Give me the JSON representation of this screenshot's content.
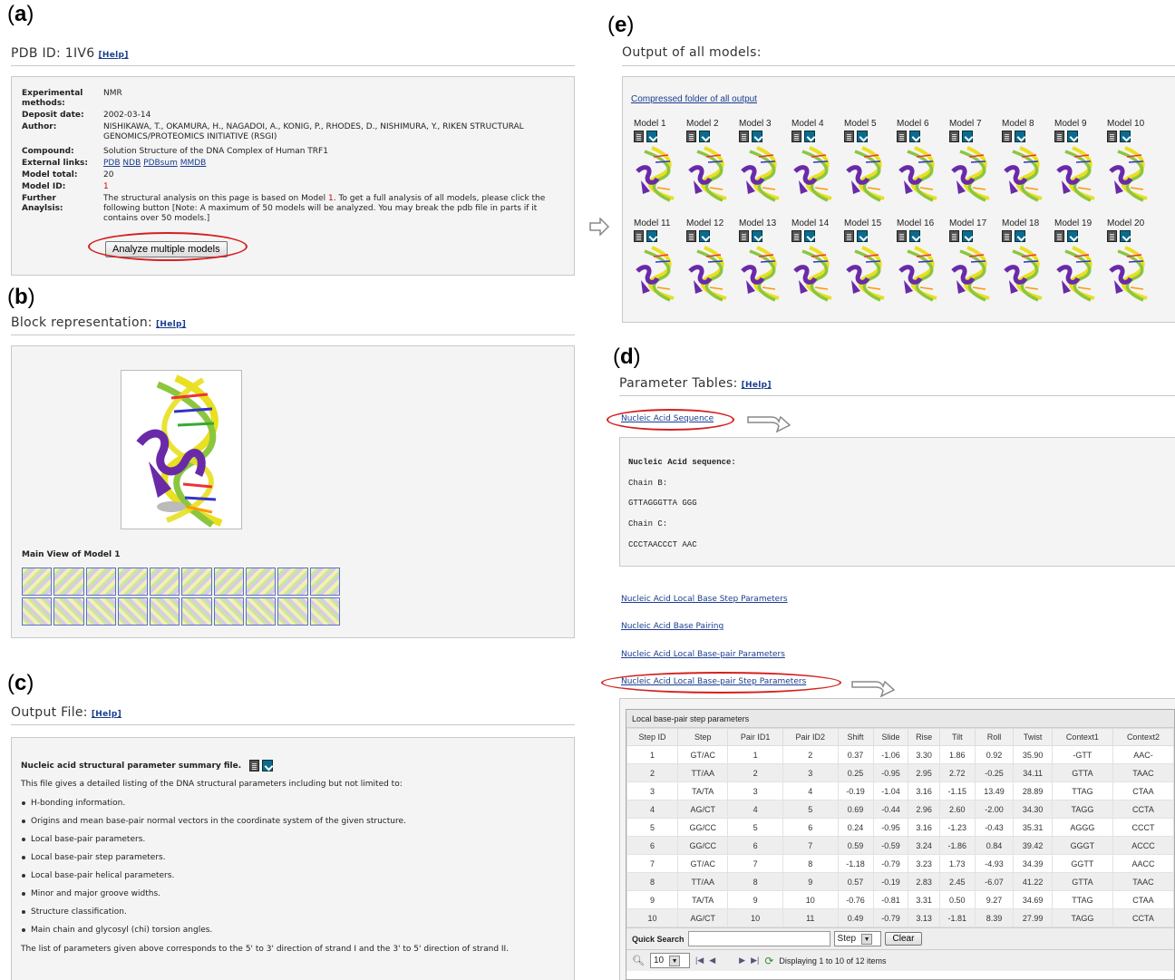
{
  "panels": {
    "a": "a",
    "b": "b",
    "c": "c",
    "d": "d",
    "e": "e"
  },
  "panel_a": {
    "title": "PDB ID: 1IV6",
    "help": "[Help]",
    "rows": [
      {
        "key": "Experimental methods:",
        "value": "NMR"
      },
      {
        "key": "Deposit date:",
        "value": "2002-03-14"
      },
      {
        "key": "Author:",
        "value": "NISHIKAWA, T., OKAMURA, H., NAGADOI, A., KONIG, P., RHODES, D., NISHIMURA, Y., RIKEN STRUCTURAL GENOMICS/PROTEOMICS INITIATIVE (RSGI)"
      },
      {
        "key": "Compound:",
        "value": "Solution Structure of the DNA Complex of Human TRF1"
      },
      {
        "key": "External links:",
        "links": [
          "PDB",
          "NDB",
          "PDBsum",
          "MMDB"
        ]
      },
      {
        "key": "Model total:",
        "value": "20"
      },
      {
        "key": "Model ID:",
        "value": "1"
      },
      {
        "key": "Further Anaylsis:",
        "value_pre": "The structural analysis on this page is based on Model ",
        "value_model": "1",
        "value_post": ". To get a full analysis of all models, please click the following button [Note: A maximum of 50 models will be analyzed. You may break the pdb file in parts if it contains over 50 models.]"
      }
    ],
    "button": "Analyze multiple models"
  },
  "panel_b": {
    "title": "Block representation:",
    "help": "[Help]",
    "caption": "Main View of Model 1"
  },
  "panel_c": {
    "title": "Output File:",
    "help": "[Help]",
    "heading": "Nucleic acid structural parameter summary file.",
    "intro": "This file gives a detailed listing of the DNA structural parameters including but not limited to:",
    "items": [
      "H-bonding information.",
      "Origins and mean base-pair normal vectors in the coordinate system of the given structure.",
      "Local base-pair parameters.",
      "Local base-pair step parameters.",
      "Local base-pair helical parameters.",
      "Minor and major groove widths.",
      "Structure classification.",
      "Main chain and glycosyl (chi) torsion angles."
    ],
    "footer": "The list of parameters given above corresponds to the 5' to 3' direction of strand I and the 3' to 5' direction of strand II."
  },
  "panel_e": {
    "title": "Output of all models:",
    "link": "Compressed folder of all output",
    "models": [
      "Model 1",
      "Model 2",
      "Model 3",
      "Model 4",
      "Model 5",
      "Model 6",
      "Model 7",
      "Model 8",
      "Model 9",
      "Model 10",
      "Model 11",
      "Model 12",
      "Model 13",
      "Model 14",
      "Model 15",
      "Model 16",
      "Model 17",
      "Model 18",
      "Model 19",
      "Model 20"
    ]
  },
  "panel_d": {
    "title": "Parameter Tables:",
    "help": "[Help]",
    "link_sequence": "Nucleic Acid Sequence",
    "seq_heading": "Nucleic Acid sequence:",
    "chain_b_label": "Chain B:",
    "chain_b_seq": "GTTAGGGTTA GGG",
    "chain_c_label": "Chain C:",
    "chain_c_seq": "CCCTAACCCT AAC",
    "links": [
      "Nucleic Acid Local Base Step Parameters",
      "Nucleic Acid Base Pairing",
      "Nucleic Acid Local Base-pair Parameters",
      "Nucleic Acid Local Base-pair Step Parameters"
    ],
    "table": {
      "caption": "Local base-pair step parameters",
      "columns": [
        "Step ID",
        "Step",
        "Pair ID1",
        "Pair ID2",
        "Shift",
        "Slide",
        "Rise",
        "Tilt",
        "Roll",
        "Twist",
        "Context1",
        "Context2"
      ],
      "rows": [
        [
          "1",
          "GT/AC",
          "1",
          "2",
          "0.37",
          "-1.06",
          "3.30",
          "1.86",
          "0.92",
          "35.90",
          "-GTT",
          "AAC-"
        ],
        [
          "2",
          "TT/AA",
          "2",
          "3",
          "0.25",
          "-0.95",
          "2.95",
          "2.72",
          "-0.25",
          "34.11",
          "GTTA",
          "TAAC"
        ],
        [
          "3",
          "TA/TA",
          "3",
          "4",
          "-0.19",
          "-1.04",
          "3.16",
          "-1.15",
          "13.49",
          "28.89",
          "TTAG",
          "CTAA"
        ],
        [
          "4",
          "AG/CT",
          "4",
          "5",
          "0.69",
          "-0.44",
          "2.96",
          "2.60",
          "-2.00",
          "34.30",
          "TAGG",
          "CCTA"
        ],
        [
          "5",
          "GG/CC",
          "5",
          "6",
          "0.24",
          "-0.95",
          "3.16",
          "-1.23",
          "-0.43",
          "35.31",
          "AGGG",
          "CCCT"
        ],
        [
          "6",
          "GG/CC",
          "6",
          "7",
          "0.59",
          "-0.59",
          "3.24",
          "-1.86",
          "0.84",
          "39.42",
          "GGGT",
          "ACCC"
        ],
        [
          "7",
          "GT/AC",
          "7",
          "8",
          "-1.18",
          "-0.79",
          "3.23",
          "1.73",
          "-4.93",
          "34.39",
          "GGTT",
          "AACC"
        ],
        [
          "8",
          "TT/AA",
          "8",
          "9",
          "0.57",
          "-0.19",
          "2.83",
          "2.45",
          "-6.07",
          "41.22",
          "GTTA",
          "TAAC"
        ],
        [
          "9",
          "TA/TA",
          "9",
          "10",
          "-0.76",
          "-0.81",
          "3.31",
          "0.50",
          "9.27",
          "34.69",
          "TTAG",
          "CTAA"
        ],
        [
          "10",
          "AG/CT",
          "10",
          "11",
          "0.49",
          "-0.79",
          "3.13",
          "-1.81",
          "8.39",
          "27.99",
          "TAGG",
          "CCTA"
        ]
      ],
      "quick_search": "Quick Search",
      "search_field": "Step",
      "clear": "Clear",
      "page_size": "10",
      "status": "Displaying 1 to 10 of 12 items"
    }
  }
}
